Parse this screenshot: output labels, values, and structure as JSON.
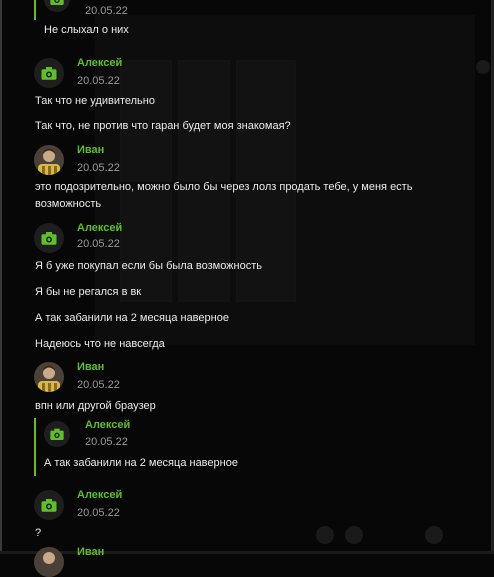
{
  "colors": {
    "accent": "#5fbf2a",
    "background": "#070707",
    "text": "#ececec",
    "muted": "#9a9a9a"
  },
  "quoted_top": {
    "date": "20.05.22",
    "text": "Не слыхал о них"
  },
  "message_groups": [
    {
      "author": "Алексей",
      "date": "20.05.22",
      "avatar_icon": "camera-icon",
      "messages": [
        "Так что не удивительно",
        "Так что, не против что гаран будет моя знакомая?"
      ]
    },
    {
      "author": "Иван",
      "date": "20.05.22",
      "avatar_icon": "user-photo",
      "messages": [
        "это подозрительно, можно было бы через лолз продать тебе, у меня есть возможность"
      ]
    },
    {
      "author": "Алексей",
      "date": "20.05.22",
      "avatar_icon": "camera-icon",
      "messages": [
        "Я б уже покупал если бы была возможность",
        "Я бы не регался в вк",
        "А так забанили на 2 месяца наверное",
        "Надеюсь что не навсегда"
      ]
    },
    {
      "author": "Иван",
      "date": "20.05.22",
      "avatar_icon": "user-photo",
      "messages": [
        "впн или другой браузер"
      ],
      "reply": {
        "author": "Алексей",
        "date": "20.05.22",
        "text": "А так забанили на 2 месяца наверное"
      }
    },
    {
      "author": "Алексей",
      "date": "20.05.22",
      "avatar_icon": "camera-icon",
      "messages": [
        "?"
      ]
    },
    {
      "author": "Иван"
    }
  ]
}
